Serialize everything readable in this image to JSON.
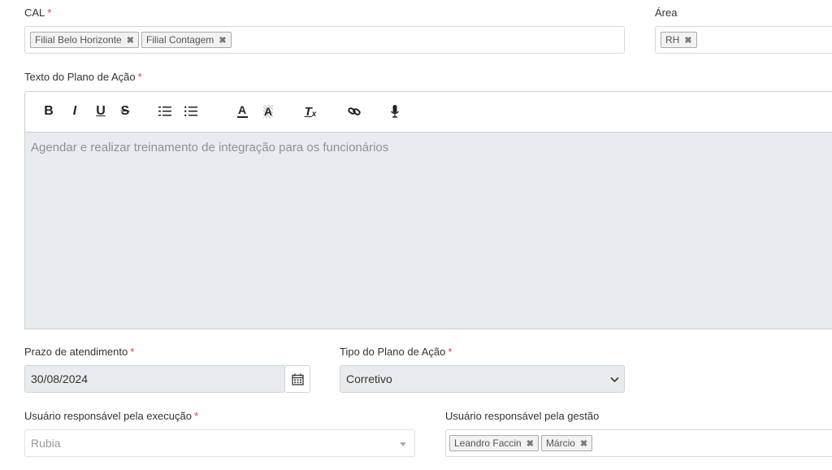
{
  "cal": {
    "label": "CAL",
    "required": "*",
    "tags": [
      "Filial Belo Horizonte",
      "Filial Contagem"
    ]
  },
  "area": {
    "label": "Área",
    "tags": [
      "RH"
    ]
  },
  "texto": {
    "label": "Texto do Plano de Ação",
    "required": "*",
    "content": "Agendar e realizar treinamento de integração para os funcionários"
  },
  "toolbar": {
    "bold": "B",
    "italic": "I",
    "underline": "U",
    "strike": "S",
    "ordered_list": "☰",
    "bullet_list": "☰",
    "text_color": "A",
    "bg_color": "A",
    "clear_format": "T",
    "clear_sub": "x"
  },
  "prazo": {
    "label": "Prazo de atendimento",
    "required": "*",
    "value": "30/08/2024"
  },
  "tipo": {
    "label": "Tipo do Plano de Ação",
    "required": "*",
    "value": "Corretivo"
  },
  "usuario_exec": {
    "label": "Usuário responsável pela execução",
    "required": "*",
    "value": "Rubia"
  },
  "usuario_gestao": {
    "label": "Usuário responsável pela gestão",
    "tags": [
      "Leandro Faccin",
      "Márcio"
    ]
  },
  "icons": {
    "remove": "remove-x-icon",
    "calendar": "calendar-icon",
    "chevron": "chevron-down-icon",
    "caret": "caret-down-icon",
    "link": "link-icon",
    "mic": "microphone-icon"
  },
  "colors": {
    "required": "#e0392b",
    "disabled_bg": "#e9ecef"
  }
}
